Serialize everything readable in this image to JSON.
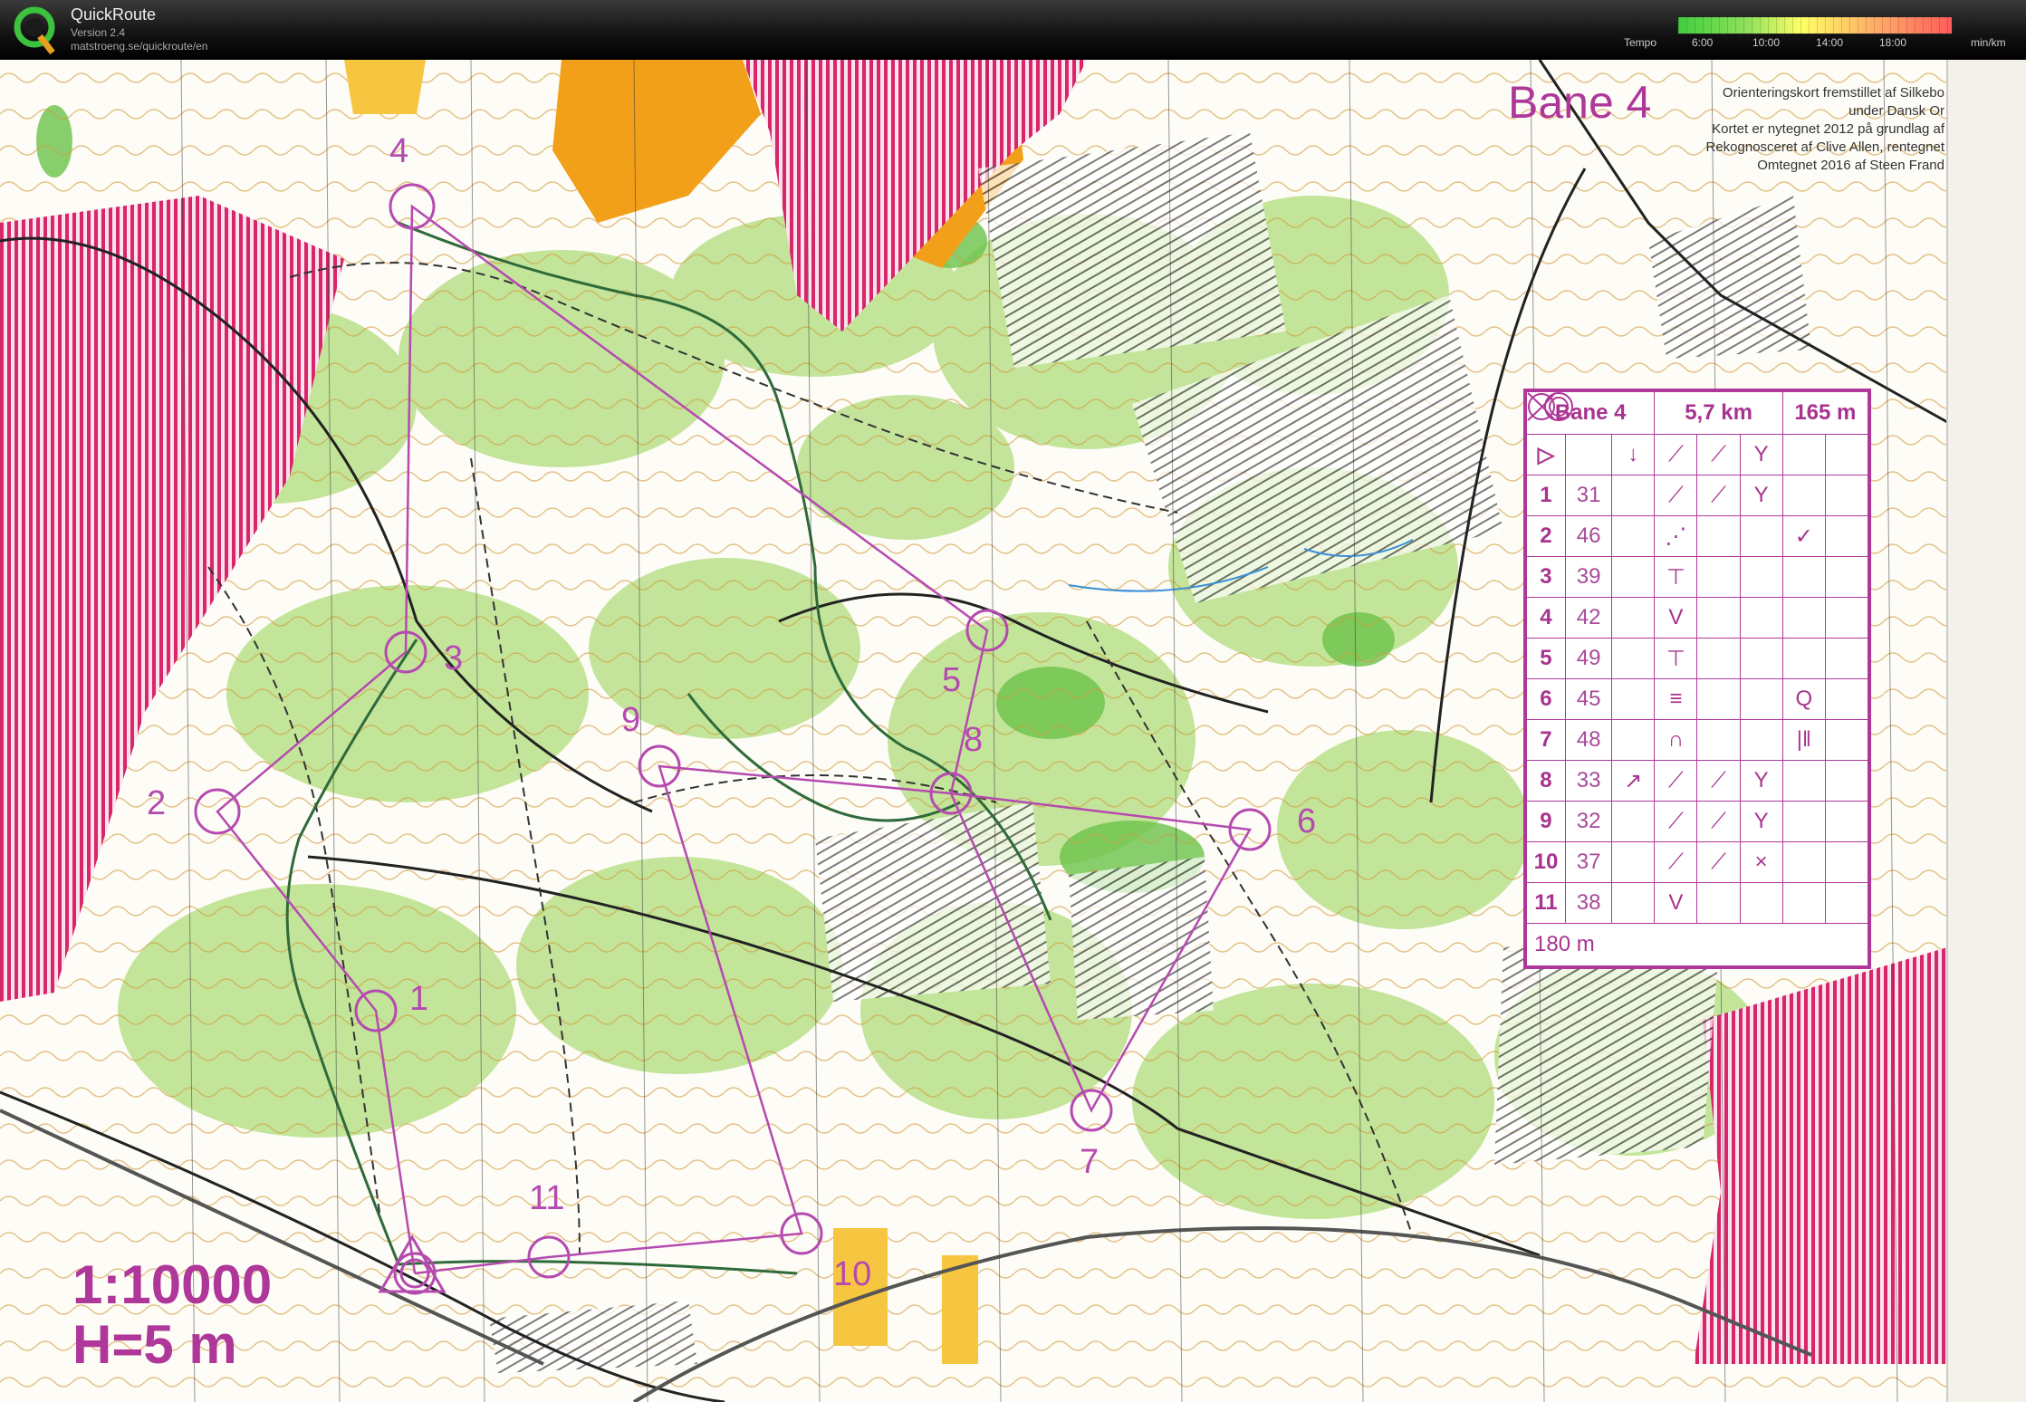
{
  "app": {
    "title": "QuickRoute",
    "version": "Version 2.4",
    "url": "matstroeng.se/quickroute/en"
  },
  "tempo": {
    "label": "Tempo",
    "ticks": [
      "6:00",
      "10:00",
      "14:00",
      "18:00"
    ],
    "unit": "min/km"
  },
  "map": {
    "course_title": "Bane 4",
    "credits": [
      "Orienteringskort fremstillet af Silkebo",
      "under Dansk Or",
      "Kortet er nytegnet 2012 på grundlag af",
      "Rekognosceret af Clive Allen, rentegnet",
      "Omtegnet 2016 af Steen Frand"
    ],
    "scale": "1:10000",
    "contour": "H=5 m",
    "controls": [
      "1",
      "2",
      "3",
      "4",
      "5",
      "6",
      "7",
      "8",
      "9",
      "10",
      "11"
    ]
  },
  "description": {
    "course": "Bane 4",
    "length": "5,7 km",
    "climb": "165 m",
    "start_symbols": [
      "▷",
      "",
      "↓",
      "⟋",
      "⟋",
      "Y",
      ""
    ],
    "rows": [
      {
        "num": "1",
        "code": "31",
        "c": "",
        "d": "⟋",
        "e": "⟋",
        "f": "Y",
        "g": ""
      },
      {
        "num": "2",
        "code": "46",
        "c": "",
        "d": "⋰",
        "e": "",
        "f": "",
        "g": "✓"
      },
      {
        "num": "3",
        "code": "39",
        "c": "",
        "d": "⊤",
        "e": "",
        "f": "",
        "g": ""
      },
      {
        "num": "4",
        "code": "42",
        "c": "",
        "d": "V",
        "e": "",
        "f": "",
        "g": ""
      },
      {
        "num": "5",
        "code": "49",
        "c": "",
        "d": "⊤",
        "e": "",
        "f": "",
        "g": ""
      },
      {
        "num": "6",
        "code": "45",
        "c": "",
        "d": "≡",
        "e": "",
        "f": "",
        "g": "Q"
      },
      {
        "num": "7",
        "code": "48",
        "c": "",
        "d": "∩",
        "e": "",
        "f": "",
        "g": "|‖"
      },
      {
        "num": "8",
        "code": "33",
        "c": "↗",
        "d": "⟋",
        "e": "⟋",
        "f": "Y",
        "g": ""
      },
      {
        "num": "9",
        "code": "32",
        "c": "",
        "d": "⟋",
        "e": "⟋",
        "f": "Y",
        "g": ""
      },
      {
        "num": "10",
        "code": "37",
        "c": "",
        "d": "⟋",
        "e": "⟋",
        "f": "×",
        "g": ""
      },
      {
        "num": "11",
        "code": "38",
        "c": "",
        "d": "V",
        "e": "",
        "f": "",
        "g": ""
      }
    ],
    "finish": "180 m"
  }
}
